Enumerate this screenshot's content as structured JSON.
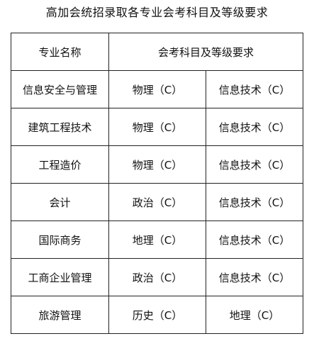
{
  "title": "高加会统招录取各专业会考科目及等级要求",
  "table": {
    "headers": [
      "专业名称",
      "会考科目及等级要求"
    ],
    "rows": [
      {
        "major": "信息安全与管理",
        "req1": "物理（C）",
        "req2": "信息技术（C）"
      },
      {
        "major": "建筑工程技术",
        "req1": "物理（C）",
        "req2": "信息技术（C）"
      },
      {
        "major": "工程造价",
        "req1": "物理（C）",
        "req2": "信息技术（C）"
      },
      {
        "major": "会计",
        "req1": "政治（C）",
        "req2": "信息技术（C）"
      },
      {
        "major": "国际商务",
        "req1": "地理（C）",
        "req2": "信息技术（C）"
      },
      {
        "major": "工商企业管理",
        "req1": "政治（C）",
        "req2": "信息技术（C）"
      },
      {
        "major": "旅游管理",
        "req1": "历史（C）",
        "req2": "地理（C）"
      }
    ]
  }
}
